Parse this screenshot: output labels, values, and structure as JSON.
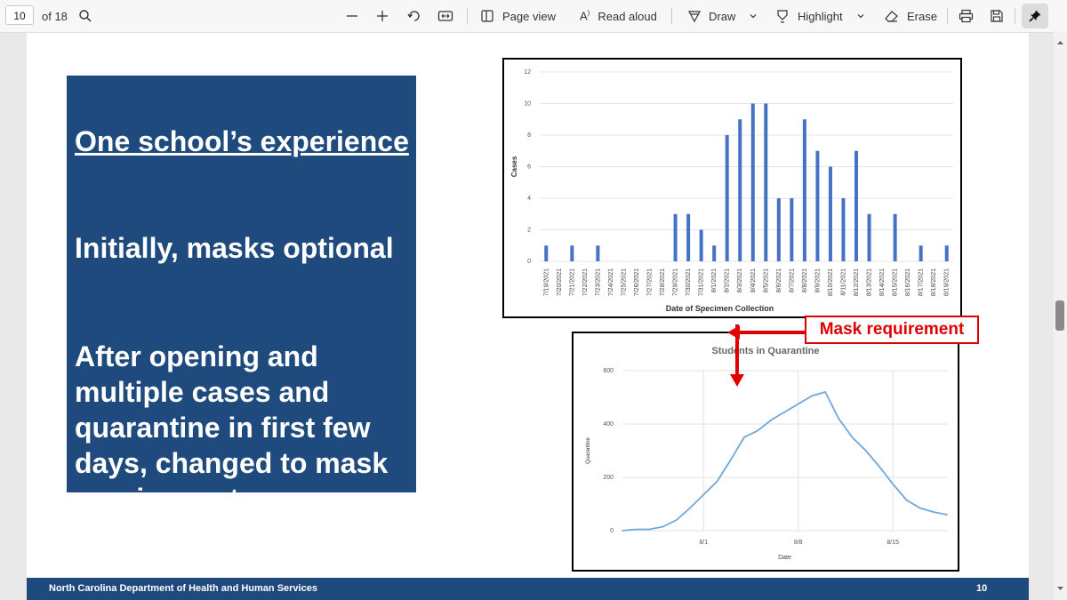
{
  "toolbar": {
    "page_current": "10",
    "page_total": "of 18",
    "page_view_label": "Page view",
    "read_aloud_label": "Read aloud",
    "draw_label": "Draw",
    "highlight_label": "Highlight",
    "erase_label": "Erase",
    "icons": [
      "search-icon",
      "zoom-out-icon",
      "zoom-in-icon",
      "rotate-icon",
      "fit-page-icon",
      "page-view-icon",
      "read-aloud-icon",
      "draw-icon",
      "chevron-down-icon",
      "highlight-icon",
      "chevron-down-icon",
      "eraser-icon",
      "print-icon",
      "save-icon",
      "pin-icon"
    ]
  },
  "slide": {
    "heading": "One school’s experience",
    "point1": "Initially, masks optional",
    "point2_lines": [
      "After opening and",
      "multiple cases and",
      "quarantine in first few",
      "days, changed to mask",
      "requirement"
    ],
    "footer_org": "North Carolina Department of Health and Human Services",
    "footer_page": "10",
    "mask_label": "Mask requirement",
    "colors": {
      "slide_blue": "#1f4a7e",
      "bar_blue": "#4472c4",
      "line_blue": "#6fa8dc",
      "annotation_red": "#e00000"
    }
  },
  "chart_data": [
    {
      "type": "bar",
      "title": "",
      "xlabel": "Date of Specimen Collection",
      "ylabel": "Cases",
      "ylim": [
        0,
        12
      ],
      "yticks": [
        0,
        2,
        4,
        6,
        8,
        10,
        12
      ],
      "grid": true,
      "categories": [
        "7/19/2021",
        "7/20/2021",
        "7/21/2021",
        "7/22/2021",
        "7/23/2021",
        "7/24/2021",
        "7/25/2021",
        "7/26/2021",
        "7/27/2021",
        "7/28/2021",
        "7/29/2021",
        "7/30/2021",
        "7/31/2021",
        "8/1/2021",
        "8/2/2021",
        "8/3/2021",
        "8/4/2021",
        "8/5/2021",
        "8/6/2021",
        "8/7/2021",
        "8/8/2021",
        "8/9/2021",
        "8/10/2021",
        "8/11/2021",
        "8/12/2021",
        "8/13/2021",
        "8/14/2021",
        "8/15/2021",
        "8/16/2021",
        "8/17/2021",
        "8/18/2021",
        "8/19/2021"
      ],
      "values": [
        1,
        0,
        1,
        0,
        1,
        0,
        0,
        0,
        0,
        0,
        3,
        3,
        2,
        1,
        8,
        9,
        10,
        10,
        4,
        4,
        9,
        7,
        6,
        4,
        7,
        3,
        0,
        3,
        0,
        1,
        0,
        1
      ]
    },
    {
      "type": "line",
      "title": "Students in Quarantine",
      "xlabel": "Date",
      "ylabel": "Quarantine",
      "ylim": [
        0,
        600
      ],
      "yticks": [
        0,
        200,
        400,
        600
      ],
      "x_ticks": [
        "8/1",
        "8/8",
        "8/15"
      ],
      "grid": true,
      "x": [
        "7/26",
        "7/27",
        "7/28",
        "7/29",
        "7/30",
        "7/31",
        "8/1",
        "8/2",
        "8/3",
        "8/4",
        "8/5",
        "8/6",
        "8/7",
        "8/8",
        "8/9",
        "8/10",
        "8/11",
        "8/12",
        "8/13",
        "8/14",
        "8/15",
        "8/16",
        "8/17",
        "8/18",
        "8/19"
      ],
      "series": [
        {
          "values": [
            0,
            5,
            5,
            15,
            40,
            85,
            135,
            185,
            265,
            350,
            375,
            415,
            445,
            475,
            505,
            520,
            420,
            350,
            300,
            240,
            175,
            115,
            85,
            70,
            60
          ]
        }
      ]
    }
  ]
}
